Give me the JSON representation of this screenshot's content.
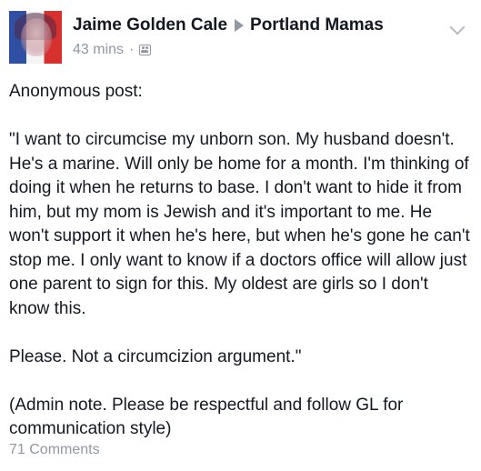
{
  "post": {
    "author": "Jaime Golden Cale",
    "group": "Portland Mamas",
    "time": "43 mins",
    "separator": "·",
    "audience_icon": "group-audience-icon",
    "menu_icon": "chevron-down-icon",
    "paragraphs": [
      "Anonymous post:",
      "\"I want to circumcise my unborn son. My husband doesn't. He's a marine. Will only be home for a month. I'm thinking of doing it when he returns to base. I don't want to hide it from him, but my mom is Jewish and it's important to me. He won't support it when he's here, but when he's gone he can't stop me. I only want to know if a doctors office will allow just one parent to sign for this. My oldest are girls so I don't know this.",
      "Please. Not a circumcizion argument.\"",
      "(Admin note. Please be respectful and follow GL for communication style)"
    ],
    "comments": "71 Comments"
  },
  "colors": {
    "text": "#141823",
    "meta": "#9197a3",
    "flag_blue": "#2f4fa2",
    "flag_white": "#f4f4f4",
    "flag_red": "#d6312f"
  }
}
